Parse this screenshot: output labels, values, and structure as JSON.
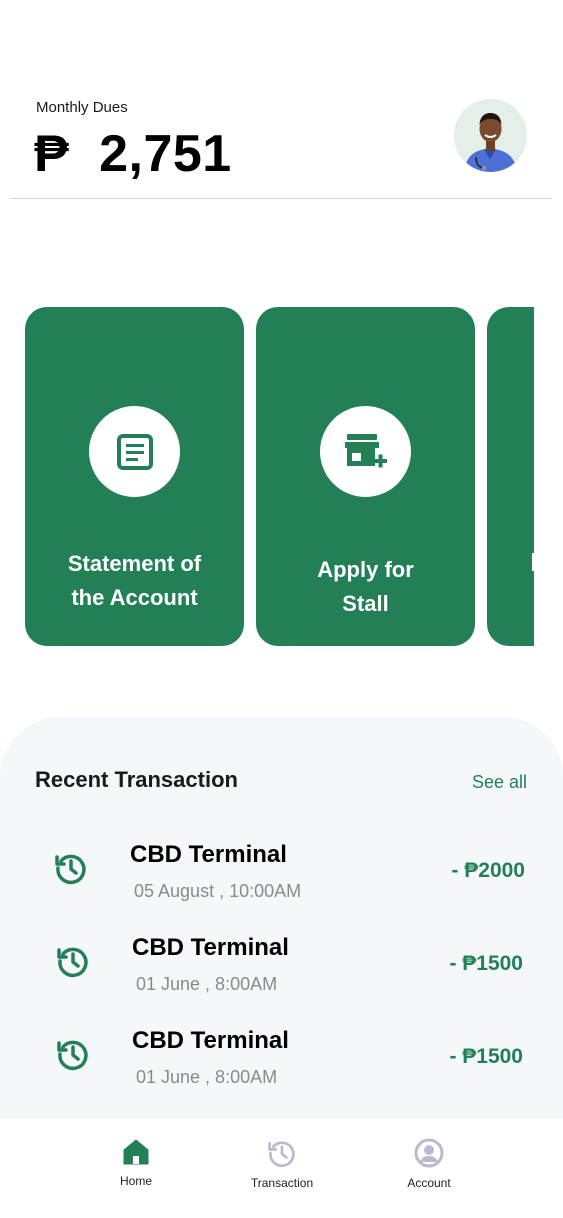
{
  "header": {
    "dues_label": "Monthly Dues",
    "currency": "₱",
    "amount": "2,751"
  },
  "cards": [
    {
      "icon": "statement-icon",
      "title_line1": "Statement of",
      "title_line2": "the Account"
    },
    {
      "icon": "store-add-icon",
      "title_line1": "Apply for",
      "title_line2": "Stall"
    }
  ],
  "recent": {
    "title": "Recent Transaction",
    "see_all": "See all",
    "items": [
      {
        "name": "CBD Terminal",
        "date": "05 August , 10:00AM",
        "amount": "- ₱2000"
      },
      {
        "name": "CBD Terminal",
        "date": "01 June , 8:00AM",
        "amount": "- ₱1500"
      },
      {
        "name": "CBD Terminal",
        "date": "01 June , 8:00AM",
        "amount": "- ₱1500"
      }
    ]
  },
  "nav": {
    "home": "Home",
    "transaction": "Transaction",
    "account": "Account"
  },
  "colors": {
    "brand_green": "#237f55",
    "panel_bg": "#f5f8fb",
    "nav_inactive": "#b9b9cf"
  }
}
